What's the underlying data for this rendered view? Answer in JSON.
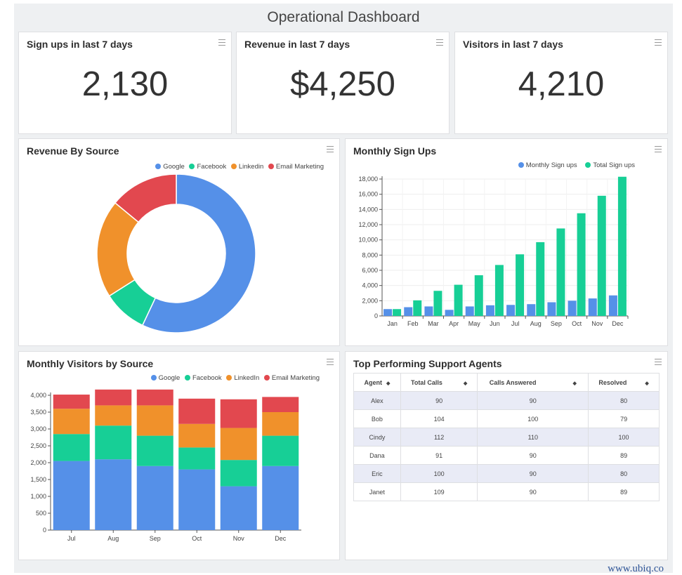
{
  "dashboard_title": "Operational Dashboard",
  "kpis": [
    {
      "title": "Sign ups in last 7 days",
      "value": "2,130"
    },
    {
      "title": "Revenue in last 7 days",
      "value": "$4,250"
    },
    {
      "title": "Visitors in last 7 days",
      "value": "4,210"
    }
  ],
  "revenue_by_source": {
    "title": "Revenue By Source",
    "legend": [
      "Google",
      "Facebook",
      "Linkedin",
      "Email Marketing"
    ]
  },
  "monthly_signups": {
    "title": "Monthly Sign Ups",
    "legend": [
      "Monthly Sign ups",
      "Total Sign ups"
    ]
  },
  "monthly_visitors": {
    "title": "Monthly Visitors by Source",
    "legend": [
      "Google",
      "Facebook",
      "LinkedIn",
      "Email Marketing"
    ]
  },
  "agents": {
    "title": "Top Performing Support Agents",
    "columns": [
      "Agent",
      "Total Calls",
      "Calls Answered",
      "Resolved"
    ],
    "rows": [
      [
        "Alex",
        "90",
        "90",
        "80"
      ],
      [
        "Bob",
        "104",
        "100",
        "79"
      ],
      [
        "Cindy",
        "112",
        "110",
        "100"
      ],
      [
        "Dana",
        "91",
        "90",
        "89"
      ],
      [
        "Eric",
        "100",
        "90",
        "80"
      ],
      [
        "Janet",
        "109",
        "90",
        "89"
      ]
    ]
  },
  "watermark": "www.ubiq.co",
  "colors": {
    "google": "#5590e8",
    "facebook": "#17cf96",
    "linkedin": "#f0912b",
    "email": "#e2484f"
  },
  "chart_data": [
    {
      "type": "pie",
      "categories": [
        "Google",
        "Facebook",
        "Linkedin",
        "Email Marketing"
      ],
      "values": [
        57,
        9,
        20,
        14
      ]
    },
    {
      "type": "bar",
      "categories": [
        "Jan",
        "Feb",
        "Mar",
        "Apr",
        "May",
        "Jun",
        "Jul",
        "Aug",
        "Sep",
        "Oct",
        "Nov",
        "Dec"
      ],
      "series": [
        {
          "name": "Monthly Sign ups",
          "values": [
            900,
            1150,
            1250,
            800,
            1250,
            1400,
            1450,
            1550,
            1800,
            2000,
            2300,
            2700
          ]
        },
        {
          "name": "Total Sign ups",
          "values": [
            900,
            2050,
            3300,
            4100,
            5350,
            6700,
            8100,
            9700,
            11500,
            13500,
            15800,
            18300
          ]
        }
      ],
      "ylim": [
        0,
        18000
      ],
      "yticks": [
        "0",
        "2,000",
        "4,000",
        "6,000",
        "8,000",
        "10,000",
        "12,000",
        "14,000",
        "16,000",
        "18,000"
      ]
    },
    {
      "type": "bar",
      "stacked": true,
      "categories": [
        "Jul",
        "Aug",
        "Sep",
        "Oct",
        "Nov",
        "Dec"
      ],
      "series": [
        {
          "name": "Google",
          "values": [
            2050,
            2100,
            1900,
            1800,
            1300,
            1900
          ]
        },
        {
          "name": "Facebook",
          "values": [
            800,
            1000,
            900,
            650,
            780,
            900
          ]
        },
        {
          "name": "LinkedIn",
          "values": [
            750,
            600,
            900,
            700,
            950,
            700
          ]
        },
        {
          "name": "Email Marketing",
          "values": [
            420,
            470,
            470,
            750,
            850,
            450
          ]
        }
      ],
      "ylim": [
        0,
        4000
      ],
      "yticks": [
        "0",
        "500",
        "1,000",
        "1,500",
        "2,000",
        "2,500",
        "3,000",
        "3,500",
        "4,000"
      ]
    }
  ]
}
